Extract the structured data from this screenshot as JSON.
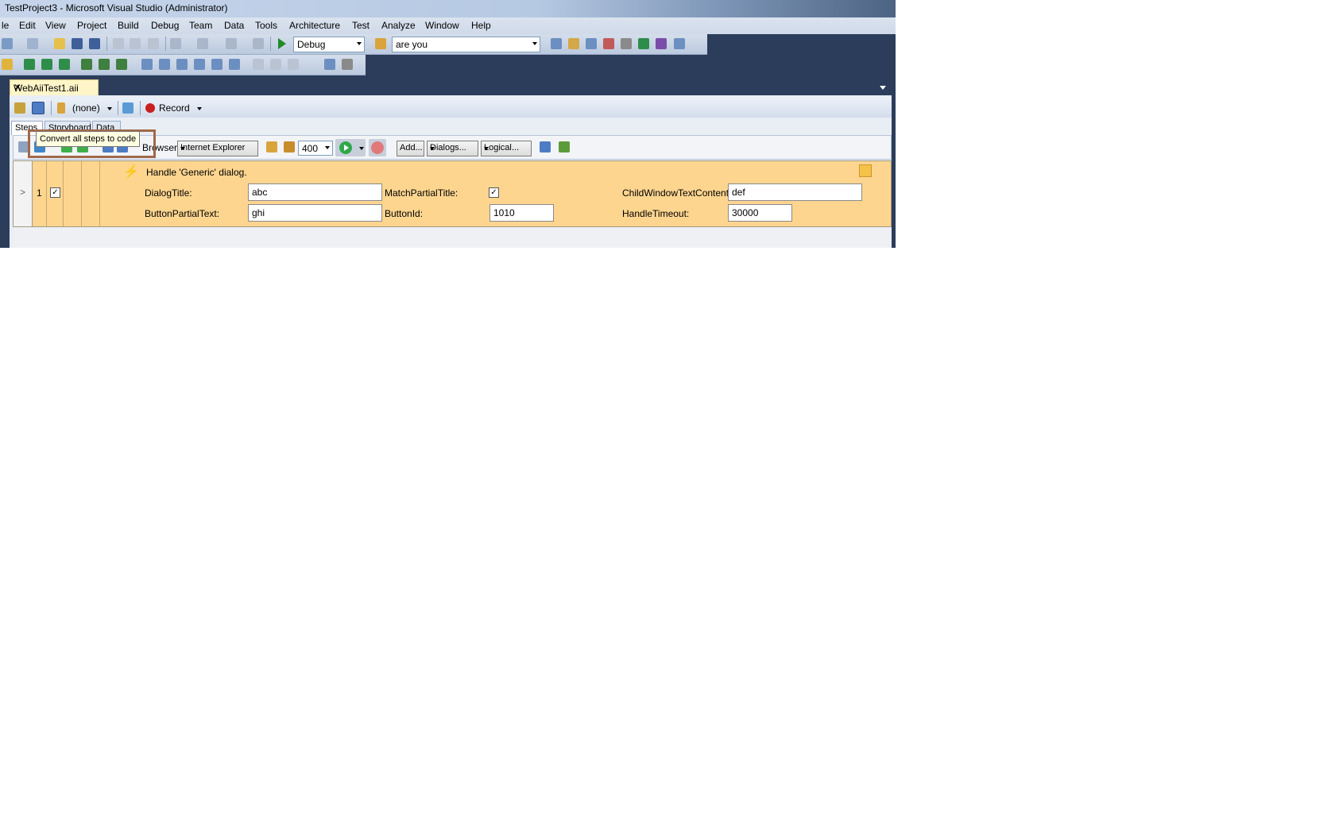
{
  "window": {
    "title": "TestProject3 - Microsoft Visual Studio (Administrator)"
  },
  "menu": [
    "le",
    "Edit",
    "View",
    "Project",
    "Build",
    "Debug",
    "Team",
    "Data",
    "Tools",
    "Architecture",
    "Test",
    "Analyze",
    "Window",
    "Help"
  ],
  "toolbar": {
    "config": "Debug",
    "find_text": "are you"
  },
  "document_tab": {
    "label": "WebAiiTest1.aii"
  },
  "editor_toolbar": {
    "datasource": "(none)",
    "record_label": "Record"
  },
  "subtabs": [
    "Steps",
    "Storyboard",
    "Data"
  ],
  "step_toolbar": {
    "browser_label": "Browser:",
    "browser_value": "Internet Explorer",
    "delay_value": "400",
    "add_label": "Add...",
    "dialogs_label": "Dialogs...",
    "logical_label": "Logical..."
  },
  "tooltip": {
    "text": "Convert all steps to code"
  },
  "step": {
    "expander": ">",
    "number": "1",
    "enabled": true,
    "description": "Handle 'Generic' dialog.",
    "fields": {
      "dialog_title_label": "DialogTitle:",
      "dialog_title_value": "abc",
      "match_partial_title_label": "MatchPartialTitle:",
      "match_partial_title_checked": true,
      "child_window_text_label": "ChildWindowTextContent:",
      "child_window_text_value": "def",
      "button_partial_text_label": "ButtonPartialText:",
      "button_partial_text_value": "ghi",
      "button_id_label": "ButtonId:",
      "button_id_value": "1010",
      "handle_timeout_label": "HandleTimeout:",
      "handle_timeout_value": "30000"
    }
  },
  "colors": {
    "accent_highlight": "#a0694a",
    "step_row": "#fdd58f",
    "vs_chrome": "#2c3d5b"
  }
}
